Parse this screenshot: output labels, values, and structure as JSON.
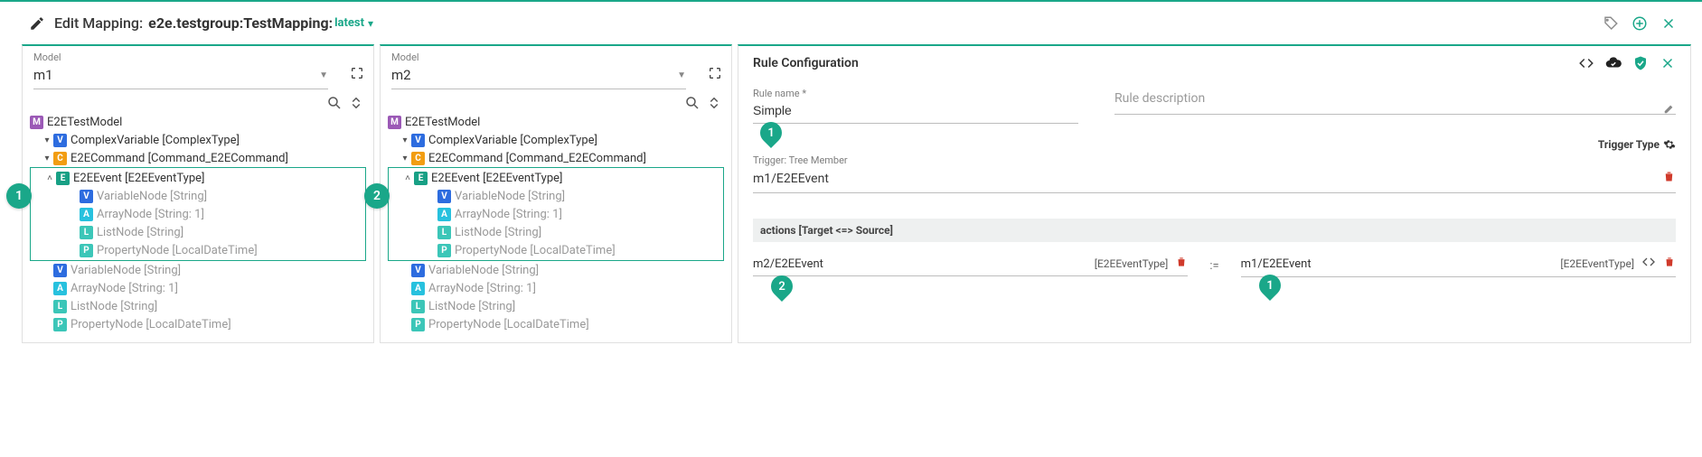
{
  "header": {
    "label": "Edit Mapping:",
    "path": "e2e.testgroup:TestMapping:",
    "version": "latest"
  },
  "panels": [
    {
      "model_label": "Model",
      "model_name": "m1",
      "marker": "1",
      "tree": {
        "root": {
          "badge": "M",
          "label": "E2ETestModel"
        },
        "complex": {
          "badge": "V",
          "label": "ComplexVariable [ComplexType]"
        },
        "command": {
          "badge": "C",
          "label": "E2ECommand [Command_E2ECommand]"
        },
        "event": {
          "badge": "E",
          "label": "E2EEvent [E2EEventType]"
        },
        "event_children": [
          {
            "badge": "V",
            "label": "VariableNode [String]"
          },
          {
            "badge": "A",
            "label": "ArrayNode [String: 1]"
          },
          {
            "badge": "L",
            "label": "ListNode [String]"
          },
          {
            "badge": "P",
            "label": "PropertyNode [LocalDateTime]"
          }
        ],
        "siblings": [
          {
            "badge": "V",
            "label": "VariableNode [String]"
          },
          {
            "badge": "A",
            "label": "ArrayNode [String: 1]"
          },
          {
            "badge": "L",
            "label": "ListNode [String]"
          },
          {
            "badge": "P",
            "label": "PropertyNode [LocalDateTime]"
          }
        ]
      }
    },
    {
      "model_label": "Model",
      "model_name": "m2",
      "marker": "2",
      "tree": {
        "root": {
          "badge": "M",
          "label": "E2ETestModel"
        },
        "complex": {
          "badge": "V",
          "label": "ComplexVariable [ComplexType]"
        },
        "command": {
          "badge": "C",
          "label": "E2ECommand [Command_E2ECommand]"
        },
        "event": {
          "badge": "E",
          "label": "E2EEvent [E2EEventType]"
        },
        "event_children": [
          {
            "badge": "V",
            "label": "VariableNode [String]"
          },
          {
            "badge": "A",
            "label": "ArrayNode [String: 1]"
          },
          {
            "badge": "L",
            "label": "ListNode [String]"
          },
          {
            "badge": "P",
            "label": "PropertyNode [LocalDateTime]"
          }
        ],
        "siblings": [
          {
            "badge": "V",
            "label": "VariableNode [String]"
          },
          {
            "badge": "A",
            "label": "ArrayNode [String: 1]"
          },
          {
            "badge": "L",
            "label": "ListNode [String]"
          },
          {
            "badge": "P",
            "label": "PropertyNode [LocalDateTime]"
          }
        ]
      }
    }
  ],
  "rule": {
    "title": "Rule Configuration",
    "name_label": "Rule name *",
    "name_value": "Simple",
    "desc_placeholder": "Rule description",
    "trigger_type_label": "Trigger Type",
    "trigger_label": "Trigger: Tree Member",
    "trigger_value": "m1/E2EEvent",
    "trigger_marker": "1",
    "actions_header": "actions [Target <=> Source]",
    "action": {
      "target_path": "m2/E2EEvent",
      "target_type": "[E2EEventType]",
      "target_marker": "2",
      "op": ":=",
      "source_path": "m1/E2EEvent",
      "source_type": "[E2EEventType]",
      "source_marker": "1"
    }
  }
}
